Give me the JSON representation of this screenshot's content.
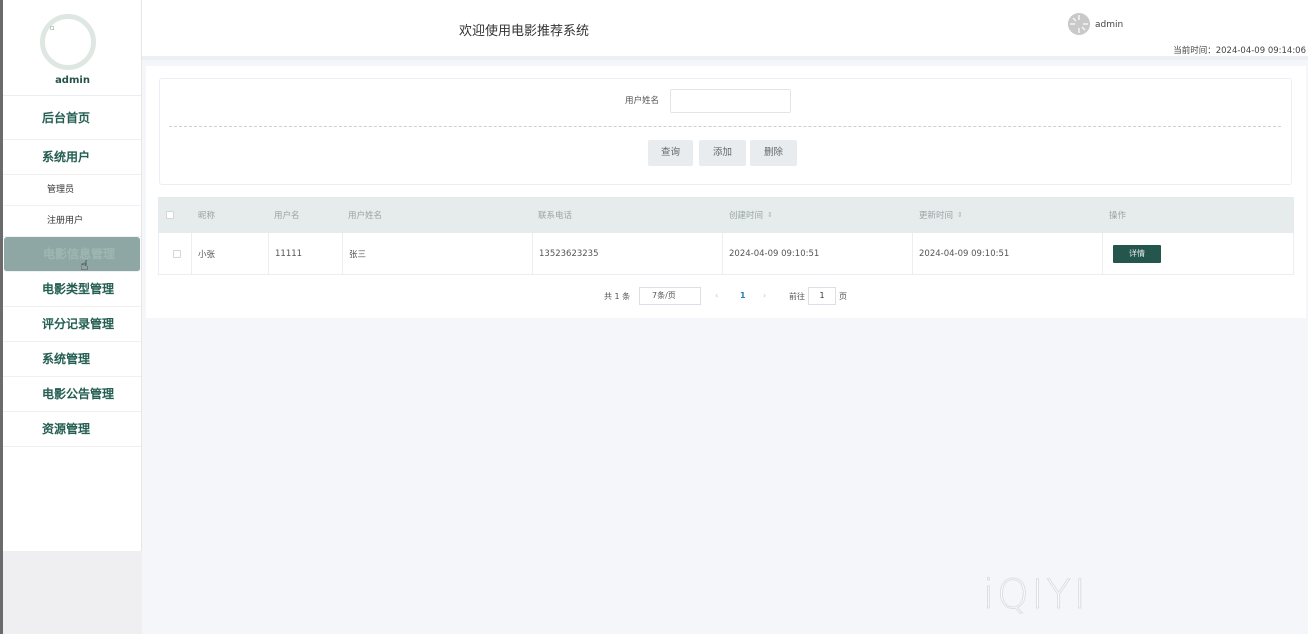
{
  "app": {
    "title": "欢迎使用电影推荐系统",
    "user": "admin",
    "time_label": "当前时间：2024-04-09 09:14:06"
  },
  "sidebar": {
    "profile_name": "admin",
    "items": [
      {
        "label": "后台首页"
      },
      {
        "label": "系统用户"
      },
      {
        "label": "管理员"
      },
      {
        "label": "注册用户"
      },
      {
        "label": "电影信息管理"
      },
      {
        "label": "电影类型管理"
      },
      {
        "label": "评分记录管理"
      },
      {
        "label": "系统管理"
      },
      {
        "label": "电影公告管理"
      },
      {
        "label": "资源管理"
      }
    ]
  },
  "search": {
    "label": "用户姓名",
    "value": "",
    "buttons": {
      "query": "查询",
      "add": "添加",
      "delete": "删除"
    }
  },
  "table": {
    "headers": [
      "昵称",
      "用户名",
      "用户姓名",
      "联系电话",
      "创建时间",
      "更新时间",
      "操作"
    ],
    "rows": [
      {
        "nickname": "小张",
        "username": "11111",
        "realname": "张三",
        "phone": "13523623235",
        "created": "2024-04-09 09:10:51",
        "updated": "2024-04-09 09:10:51",
        "action": "详情"
      }
    ]
  },
  "pagination": {
    "total": "共 1 条",
    "page_size": "7条/页",
    "current": "1",
    "goto_label": "前往",
    "goto_value": "1",
    "page_suffix": "页"
  },
  "watermark": "iQIYI"
}
